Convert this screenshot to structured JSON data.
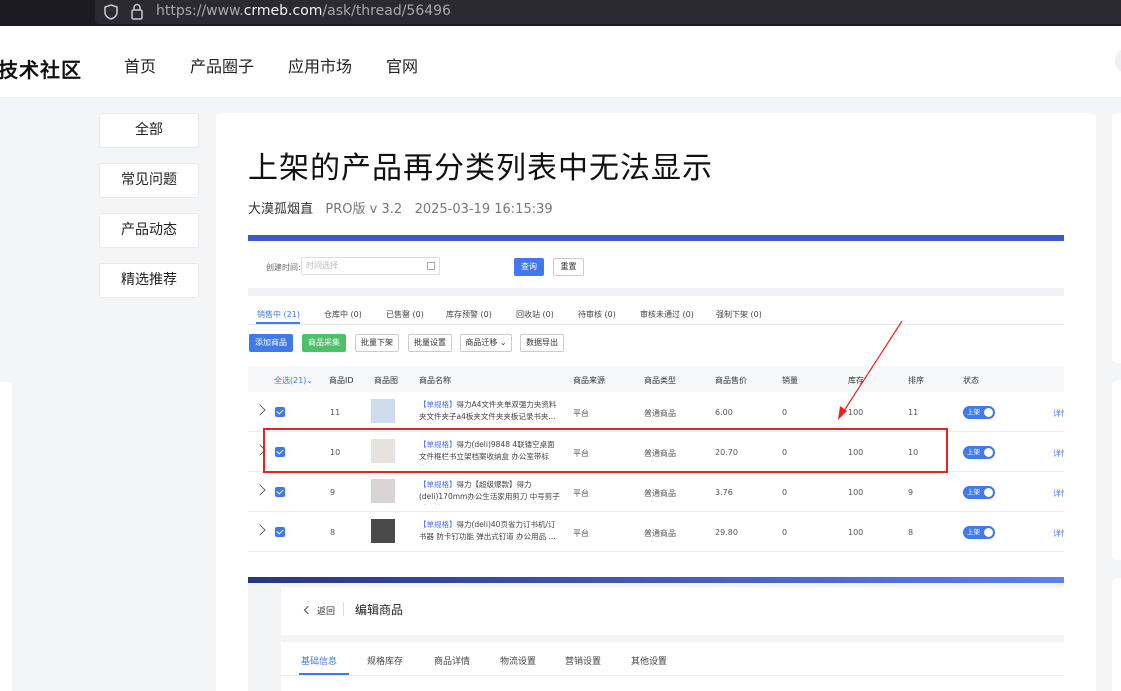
{
  "browser": {
    "url_prefix": "https://www.",
    "url_domain": "crmeb.com",
    "url_path": "/ask/thread/56496"
  },
  "header": {
    "logo": "技术社区",
    "nav": [
      "首页",
      "产品圈子",
      "应用市场",
      "官网"
    ]
  },
  "sidebar": {
    "items": [
      "全部",
      "常见问题",
      "产品动态",
      "精选推荐"
    ]
  },
  "post": {
    "title": "上架的产品再分类列表中无法显示",
    "author": "大漠孤烟直",
    "version": "PRO版 v 3.2",
    "datetime": "2025-03-19 16:15:39"
  },
  "screenshot1": {
    "filter_label": "创建时间:",
    "date_placeholder": "时间选择",
    "query_btn": "查询",
    "reset_btn": "重置",
    "tabs": [
      "销售中 (21)",
      "仓库中 (0)",
      "已售罄 (0)",
      "库存预警 (0)",
      "回收站 (0)",
      "待审核 (0)",
      "审核未通过 (0)",
      "强制下架 (0)"
    ],
    "actions": [
      "添加商品",
      "商品采集",
      "批量下架",
      "批量设置",
      "商品迁移 ⌄",
      "数据导出"
    ],
    "columns": [
      "全选(21)⌄",
      "商品ID",
      "商品图",
      "商品名称",
      "商品来源",
      "商品类型",
      "商品售价",
      "销量",
      "库存",
      "排序",
      "状态"
    ],
    "rows": [
      {
        "id": "11",
        "tag": "【单规格】",
        "name": "得力A4文件夹单双强力夹资料夹文件夹子a4板夹文件夹夹板记录书夹...",
        "source": "平台",
        "type": "普通商品",
        "price": "6.00",
        "sales": "0",
        "stock": "100",
        "sort": "11",
        "status": "上架",
        "detail": "详情"
      },
      {
        "id": "10",
        "tag": "【单规格】",
        "name": "得力(deli)9848 4联镂空桌面文件框栏书立架档案收纳盒 办公室带标签...",
        "source": "平台",
        "type": "普通商品",
        "price": "20.70",
        "sales": "0",
        "stock": "100",
        "sort": "10",
        "status": "上架",
        "detail": "详情"
      },
      {
        "id": "9",
        "tag": "【单规格】",
        "name": "得力【超级爆款】得力(deli)170mm办公生活家用剪刀 中号剪子手工剪...",
        "source": "平台",
        "type": "普通商品",
        "price": "3.76",
        "sales": "0",
        "stock": "100",
        "sort": "9",
        "status": "上架",
        "detail": "详情"
      },
      {
        "id": "8",
        "tag": "【单规格】",
        "name": "得力(deli)40页省力订书机/订书器 防卡钉功能 弹出式钉道 办公用品 ...",
        "source": "平台",
        "type": "普通商品",
        "price": "29.80",
        "sales": "0",
        "stock": "100",
        "sort": "8",
        "status": "上架",
        "detail": "详情"
      }
    ]
  },
  "screenshot2": {
    "back_label": "返回",
    "edit_title": "编辑商品",
    "tabs": [
      "基础信息",
      "规格库存",
      "商品详情",
      "物流设置",
      "营销设置",
      "其他设置"
    ]
  },
  "colors": {
    "accent": "#3f7ae8",
    "highlight": "#e02525"
  }
}
